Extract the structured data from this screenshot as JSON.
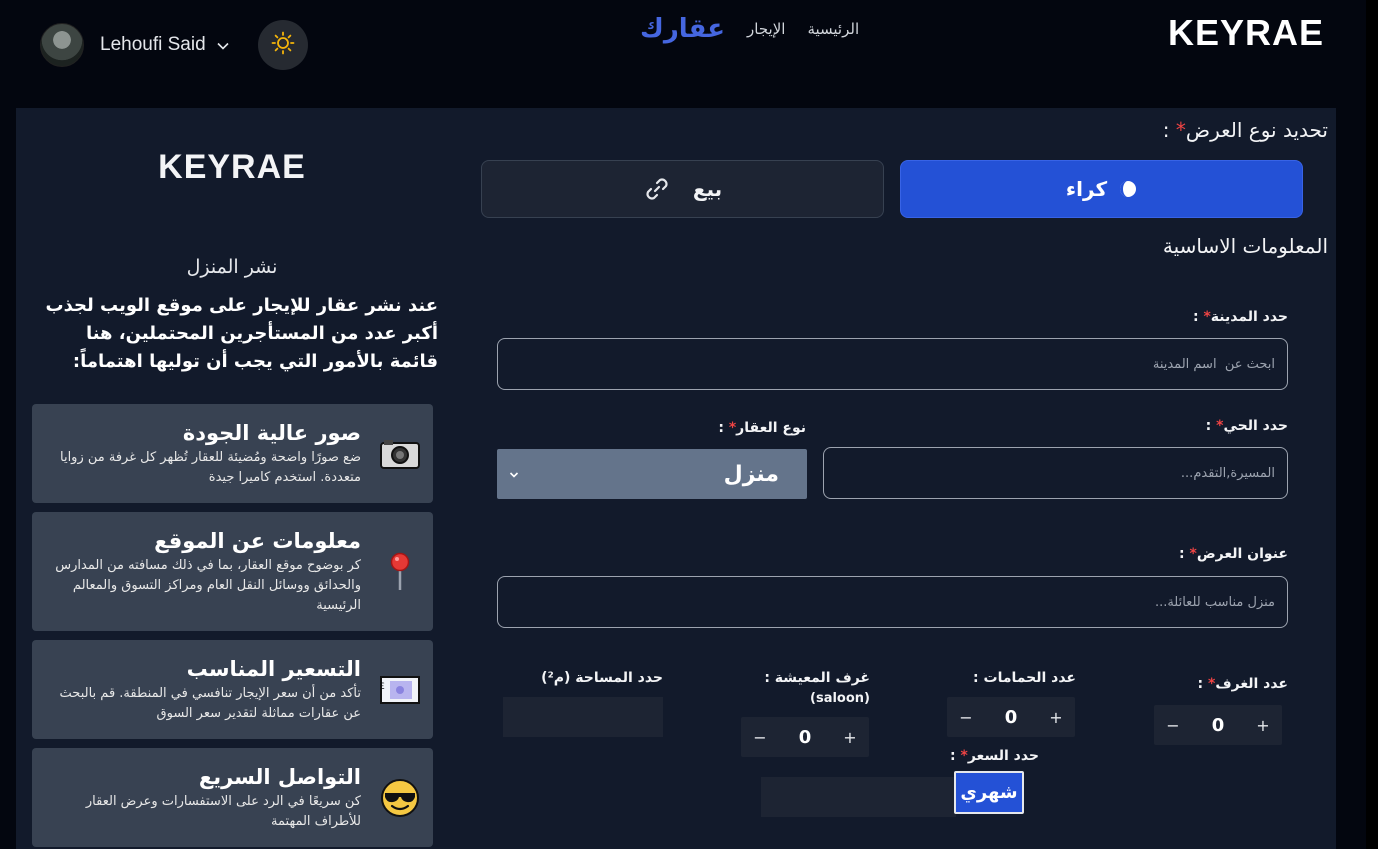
{
  "header": {
    "brand": "KEYRAE",
    "nav": {
      "home": "الرئيسية",
      "rent": "الإيجار",
      "logo": "عقارك"
    },
    "user_name": "Lehoufi Said"
  },
  "info": {
    "brand": "KEYRAE",
    "subtitle": "نشر المنزل",
    "intro": "عند نشر عقار للإيجار على موقع الويب لجذب أكبر عدد من المستأجرين المحتملين، هنا قائمة بالأمور التي يجب أن توليها اهتماماً:",
    "cards": [
      {
        "title": "صور عالية الجودة",
        "desc": "ضع صورًا واضحة ومُضيئة للعقار تُظهر كل غرفة من زوايا متعددة. استخدم كاميرا جيدة",
        "icon": "camera-icon"
      },
      {
        "title": "معلومات عن الموقع",
        "desc": "كر بوضوح موقع العقار، بما في ذلك مسافته من المدارس والحدائق ووسائل النقل العام ومراكز التسوق والمعالم الرئيسية",
        "icon": "pushpin-icon"
      },
      {
        "title": "التسعير المناسب",
        "desc": "تأكد من أن سعر الإيجار تنافسي في المنطقة. قم بالبحث عن عقارات مماثلة لتقدير سعر السوق",
        "icon": "banknote-icon"
      },
      {
        "title": "التواصل السريع",
        "desc": "كن سريعًا في الرد على الاستفسارات وعرض العقار للأطراف المهتمة",
        "icon": "sunglasses-face-icon"
      }
    ]
  },
  "form": {
    "offer_type_label": "تحديد نوع العرض",
    "offer_suffix": " :",
    "rent_label": "كراء",
    "sale_label": "بيع",
    "basic_info_title": "المعلومات الاساسية",
    "city": {
      "label": "حدد المدينة",
      "placeholder": "ابحث عن  اسم المدينة"
    },
    "district": {
      "label": "حدد الحي",
      "placeholder": "المسيرة,التقدم..."
    },
    "property_type": {
      "label": "نوع العقار",
      "value": "منزل"
    },
    "offer_title": {
      "label": "عنوان العرض",
      "placeholder": "منزل مناسب للعائلة..."
    },
    "rooms": {
      "label": "عدد الغرف",
      "value": "0"
    },
    "bathrooms": {
      "label": "عدد الحمامات :",
      "value": "0"
    },
    "living_rooms": {
      "label": "غرف المعيشة :",
      "sublabel": "(saloon)",
      "value": "0"
    },
    "area": {
      "label": "حدد المساحة (م²)"
    },
    "price": {
      "label": "حدد السعر",
      "period": "شهري"
    },
    "colon": " :",
    "star": "*"
  },
  "colors": {
    "accent": "#2451d6",
    "logo": "#4566e0",
    "panel": "#121a2b",
    "card": "#384252",
    "required": "#ef4444"
  }
}
